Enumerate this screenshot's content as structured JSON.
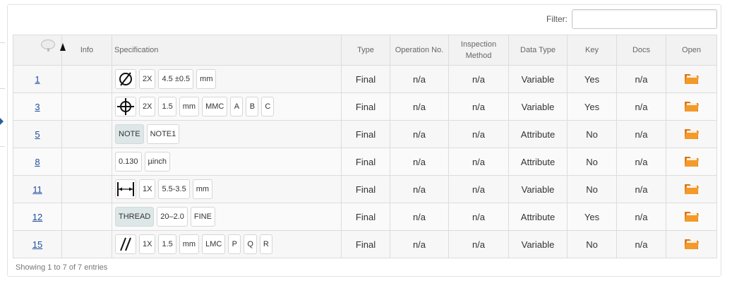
{
  "filter": {
    "label": "Filter:",
    "value": "",
    "placeholder": ""
  },
  "columns": {
    "id": "",
    "info": "Info",
    "specification": "Specification",
    "type": "Type",
    "operation_no": "Operation No.",
    "inspection_method": "Inspection Method",
    "data_type": "Data Type",
    "key": "Key",
    "docs": "Docs",
    "open": "Open"
  },
  "rows": [
    {
      "id": "1",
      "symbol": "diameter",
      "chips": [
        "2X",
        "4.5  ±0.5",
        "mm"
      ],
      "type": "Final",
      "operation_no": "n/a",
      "inspection_method": "n/a",
      "data_type": "Variable",
      "key": "Yes",
      "docs": "n/a"
    },
    {
      "id": "3",
      "symbol": "position",
      "chips": [
        "2X",
        "1.5",
        "mm",
        "MMC",
        "A",
        "B",
        "C"
      ],
      "type": "Final",
      "operation_no": "n/a",
      "inspection_method": "n/a",
      "data_type": "Variable",
      "key": "Yes",
      "docs": "n/a"
    },
    {
      "id": "5",
      "symbol": "",
      "gray": "NOTE",
      "chips": [
        "NOTE1"
      ],
      "type": "Final",
      "operation_no": "n/a",
      "inspection_method": "n/a",
      "data_type": "Attribute",
      "key": "No",
      "docs": "n/a"
    },
    {
      "id": "8",
      "symbol": "",
      "chips": [
        "0.130",
        "µinch"
      ],
      "type": "Final",
      "operation_no": "n/a",
      "inspection_method": "n/a",
      "data_type": "Attribute",
      "key": "No",
      "docs": "n/a"
    },
    {
      "id": "11",
      "symbol": "width",
      "chips": [
        "1X",
        "5.5-3.5",
        "mm"
      ],
      "type": "Final",
      "operation_no": "n/a",
      "inspection_method": "n/a",
      "data_type": "Variable",
      "key": "No",
      "docs": "n/a"
    },
    {
      "id": "12",
      "symbol": "",
      "gray": "THREAD",
      "chips": [
        "20–2.0",
        "FINE"
      ],
      "type": "Final",
      "operation_no": "n/a",
      "inspection_method": "n/a",
      "data_type": "Attribute",
      "key": "Yes",
      "docs": "n/a"
    },
    {
      "id": "15",
      "symbol": "parallelism",
      "chips": [
        "1X",
        "1.5",
        "mm",
        "LMC",
        "P",
        "Q",
        "R"
      ],
      "type": "Final",
      "operation_no": "n/a",
      "inspection_method": "n/a",
      "data_type": "Variable",
      "key": "No",
      "docs": "n/a"
    }
  ],
  "footer": {
    "info": "Showing 1 to 7 of 7 entries"
  },
  "icons": {
    "open": "open-folder-icon",
    "sort": "sort-ascending-icon",
    "comment": "comment-bubble-icon"
  },
  "colors": {
    "link": "#1f4e9e",
    "folder": "#f08a1c",
    "note_chip": "#dde7e7"
  }
}
